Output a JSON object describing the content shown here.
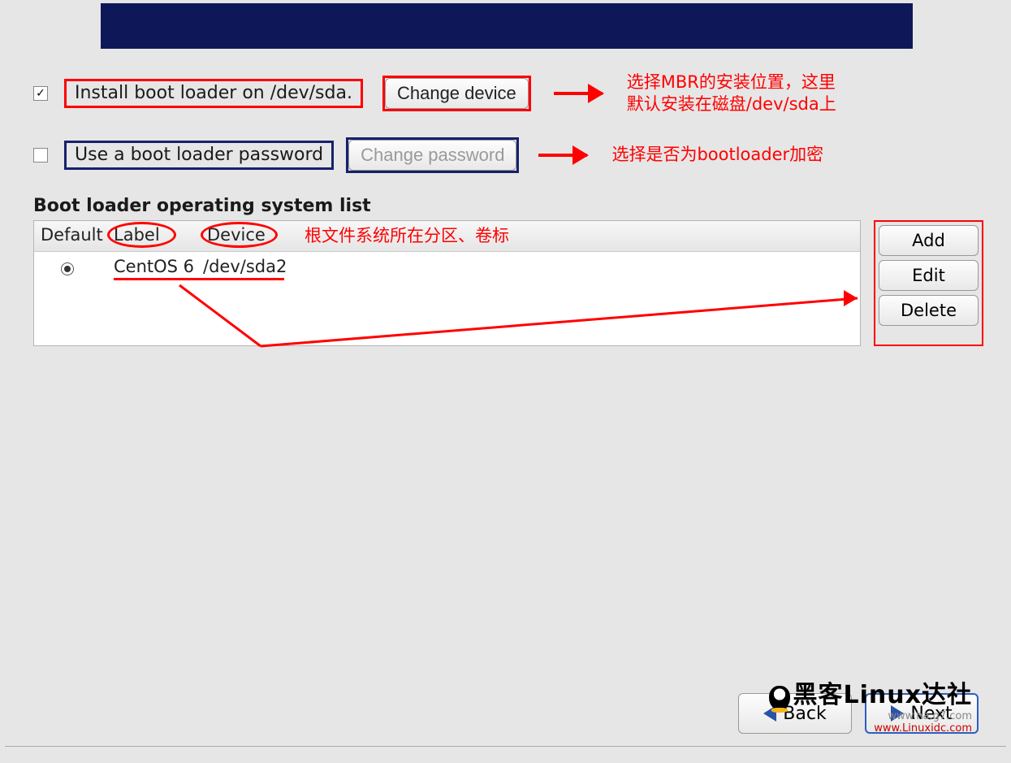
{
  "install_row": {
    "checked": true,
    "label": "Install boot loader on /dev/sda.",
    "button": "Change device",
    "annotation_line1": "选择MBR的安装位置，这里",
    "annotation_line2": "默认安装在磁盘/dev/sda上"
  },
  "password_row": {
    "checked": false,
    "label": "Use a boot loader password",
    "button": "Change password",
    "annotation": "选择是否为bootloader加密"
  },
  "os_list": {
    "title": "Boot loader operating system list",
    "headers": {
      "default": "Default",
      "label": "Label",
      "device": "Device"
    },
    "header_annotation": "根文件系统所在分区、卷标",
    "row": {
      "selected": true,
      "label": "CentOS 6",
      "device": "/dev/sda2"
    },
    "side_buttons": {
      "add": "Add",
      "edit": "Edit",
      "delete": "Delete"
    }
  },
  "nav": {
    "back": "Back",
    "next": "Next"
  },
  "watermark": {
    "main": "黑客Linux达社",
    "sub1": "www.ha.g7.com",
    "sub2": "www.Linuxidc.com"
  }
}
